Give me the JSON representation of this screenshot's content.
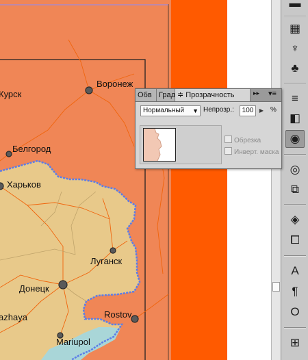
{
  "map": {
    "cities": [
      {
        "name": "Voronezh",
        "label": "Воронеж"
      },
      {
        "name": "Kursk",
        "label": "Курск"
      },
      {
        "name": "Belgorod",
        "label": "Белгород"
      },
      {
        "name": "Kharkov",
        "label": "Харьков"
      },
      {
        "name": "Lugansk",
        "label": "Луганск"
      },
      {
        "name": "Donetsk",
        "label": "Донецк"
      },
      {
        "name": "Zaporozhye",
        "label": "azhaya"
      },
      {
        "name": "Rostov",
        "label": "Rostov"
      },
      {
        "name": "Mariupol",
        "label": "Mariupol"
      }
    ],
    "colors": {
      "region_outer": "#f08656",
      "region_inner": "#e8c98a",
      "sea": "#a9d6d8",
      "roads": "#f0640c",
      "selection": "#5b7de8",
      "side_strip": "#ff5a00"
    }
  },
  "panel": {
    "tabs": [
      "Обв",
      "Град",
      "≑ Прозрачность"
    ],
    "blend_mode": "Нормальный",
    "opacity_label": "Непрозр.:",
    "opacity_value": "100",
    "opacity_unit": "%",
    "checkbox_clip": "Обрезка",
    "checkbox_invert": "Инверт. маска",
    "icons": [
      "double-arrow-icon",
      "panel-menu-icon",
      "stepper-arrow-icon"
    ]
  },
  "toolbar": {
    "icons": [
      "panel-top-icon",
      "swatches-icon",
      "brush-icon",
      "club-symbol-icon",
      "stroke-icon",
      "gradient-icon",
      "transparency-icon",
      "appearance-icon",
      "graphic-styles-icon",
      "layers-icon",
      "artboards-icon",
      "character-icon",
      "paragraph-icon",
      "opentype-icon",
      "align-icon"
    ],
    "glyphs": [
      "▬",
      "▦",
      "♆",
      "♣",
      "≡",
      "◧",
      "◉",
      "◎",
      "⧉",
      "◈",
      "⧠",
      "A",
      "¶",
      "O",
      "⊞"
    ]
  }
}
